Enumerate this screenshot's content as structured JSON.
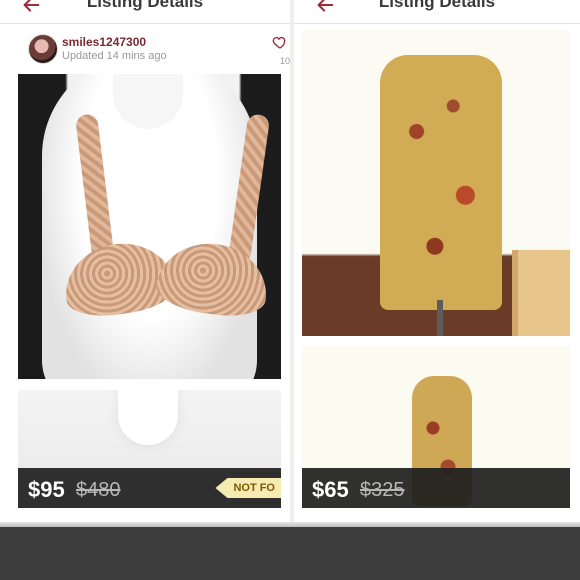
{
  "left_panel": {
    "header": {
      "title": "Listing Details"
    },
    "seller": {
      "username": "smiles1247300",
      "updated": "Updated 14 mins ago",
      "likes": "10"
    },
    "listing": {
      "price": "$95",
      "original_price": "$480",
      "badge": "NOT FO"
    }
  },
  "right_panel": {
    "header": {
      "title": "Listing Details"
    },
    "listing": {
      "price": "$65",
      "original_price": "$325"
    }
  },
  "colors": {
    "back_arrow": "#9b2c3a",
    "username": "#7a2a35",
    "badge_bg": "#f7ebb4"
  },
  "icons": {
    "back": "back-arrow-icon",
    "like": "heart-outline-icon"
  }
}
